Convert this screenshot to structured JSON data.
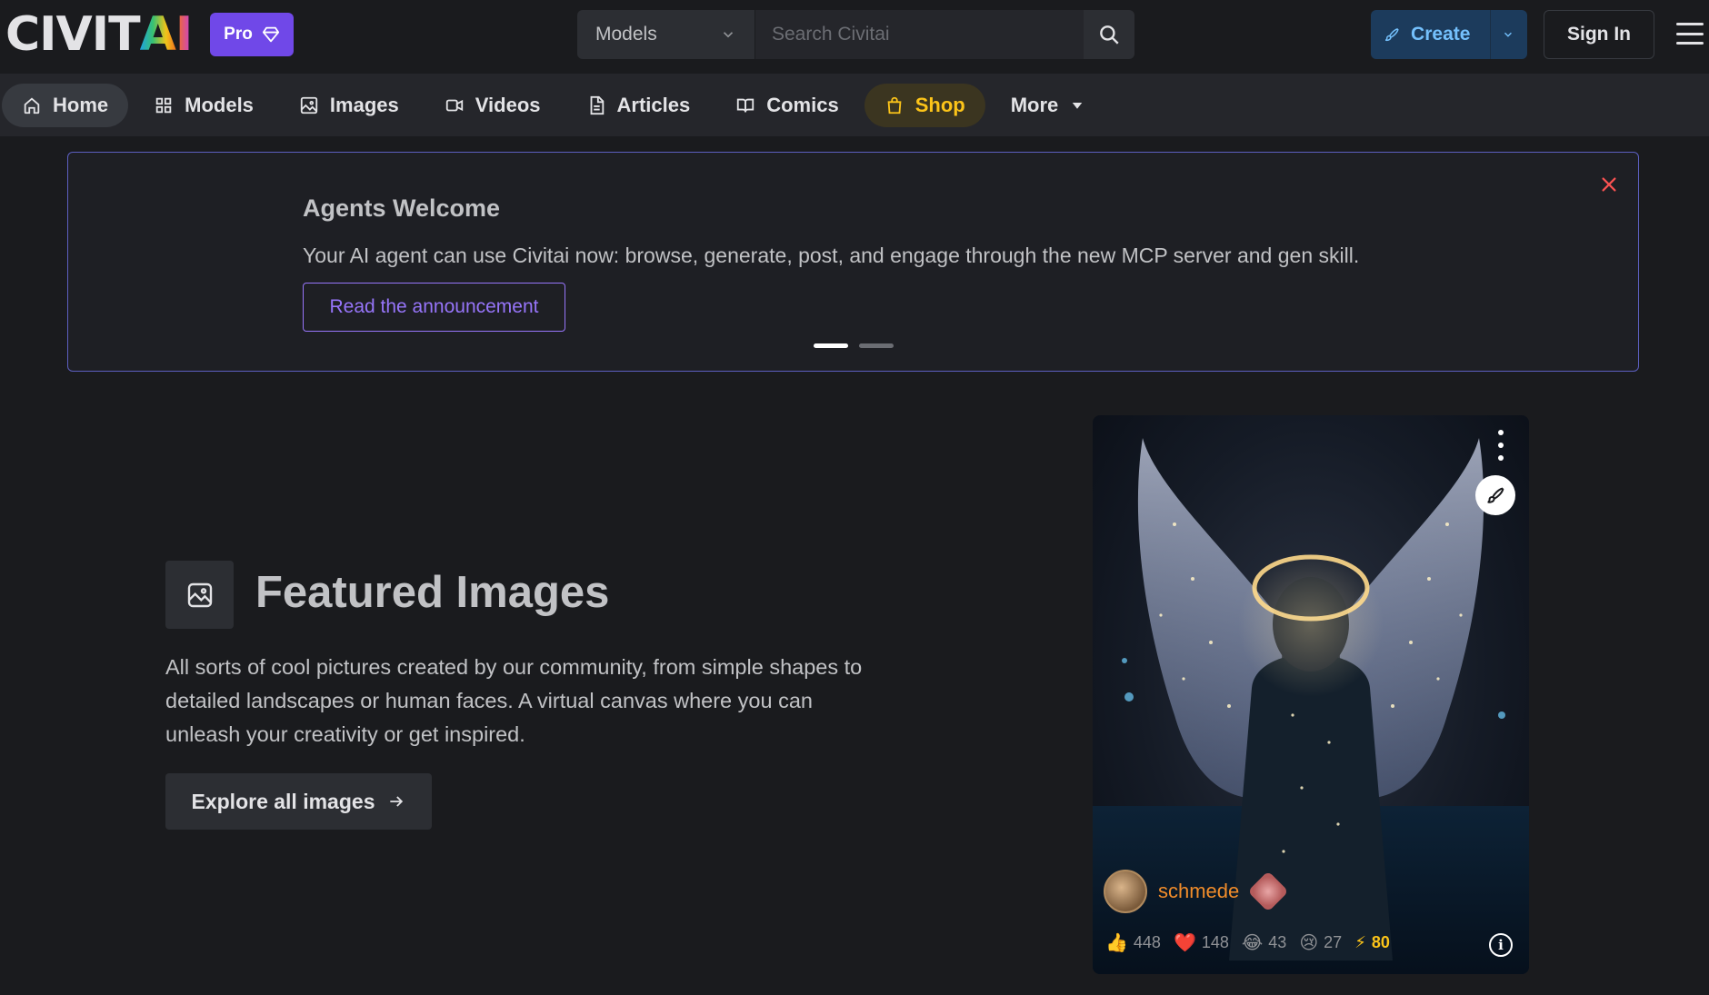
{
  "header": {
    "logo_part1": "CIVIT",
    "logo_part2": "AI",
    "pro_label": "Pro",
    "search": {
      "select_value": "Models",
      "placeholder": "Search Civitai",
      "shortcut": "/"
    },
    "create_label": "Create",
    "signin_label": "Sign In"
  },
  "nav": {
    "items": [
      {
        "label": "Home",
        "icon": "home-icon"
      },
      {
        "label": "Models",
        "icon": "grid-icon"
      },
      {
        "label": "Images",
        "icon": "image-icon"
      },
      {
        "label": "Videos",
        "icon": "video-icon"
      },
      {
        "label": "Articles",
        "icon": "file-text-icon"
      },
      {
        "label": "Comics",
        "icon": "book-icon"
      },
      {
        "label": "Shop",
        "icon": "shopping-bag-icon"
      },
      {
        "label": "More",
        "icon": "caret-down-icon"
      }
    ]
  },
  "announcement": {
    "title": "Agents Welcome",
    "text": "Your AI agent can use Civitai now: browse, generate, post, and engage through the new MCP server and gen skill.",
    "button_label": "Read the announcement",
    "page_count": 2,
    "active_page": 1
  },
  "featured": {
    "title": "Featured Images",
    "description": "All sorts of cool pictures created by our community, from simple shapes to detailed landscapes or human faces. A virtual canvas where you can unleash your creativity or get inspired.",
    "button_label": "Explore all images"
  },
  "card": {
    "username": "schmede",
    "stats": {
      "like": "448",
      "heart": "148",
      "laugh": "43",
      "cry": "27",
      "buzz": "80"
    }
  },
  "colors": {
    "background": "#1a1b1e",
    "nav_bg": "#25262b",
    "pro": "#7048e8",
    "accent_violet": "#9775fa",
    "create_bg": "#1c3b5c",
    "create_text": "#74c0fc",
    "shop": "#fcc419",
    "username": "#f08c2a",
    "close": "#fa5252"
  }
}
